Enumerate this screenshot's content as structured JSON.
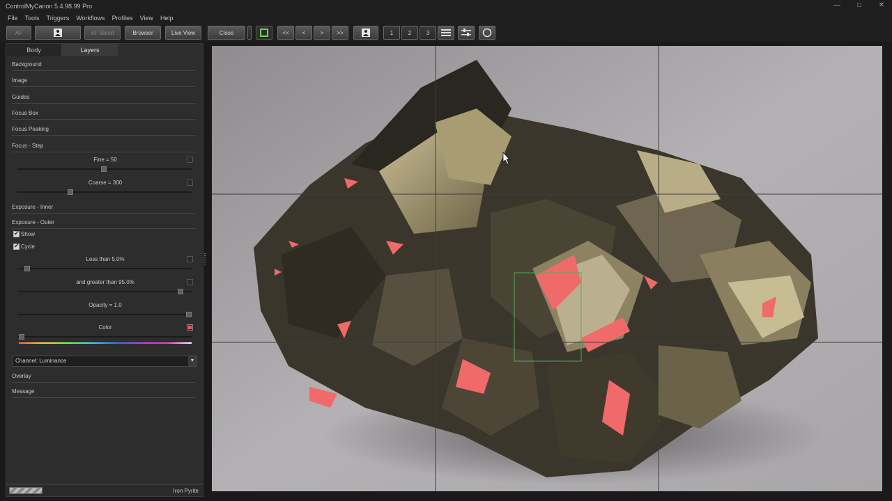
{
  "window": {
    "title": "ControlMyCanon 5.4.98.99 Pro"
  },
  "menu": [
    "File",
    "Tools",
    "Triggers",
    "Workflows",
    "Profiles",
    "View",
    "Help"
  ],
  "toolbar": {
    "af": "AF",
    "af_shoot": "AF Shoot",
    "browser": "Browser",
    "live_view": "Live View",
    "close": "Close",
    "first": "<<",
    "prev": "<",
    "next": ">",
    "last": ">>",
    "one": "1",
    "two": "2",
    "three": "3"
  },
  "tabs": {
    "body": "Body",
    "layers": "Layers"
  },
  "layers": {
    "background": "Background",
    "image": "Image",
    "guides": "Guides",
    "focus_box": "Focus Box",
    "focus_peaking": "Focus Peaking",
    "focus_step": "Focus - Step",
    "fine": "Fine = 50",
    "coarse": "Coarse = 300",
    "exposure_inner": "Exposure - Inner",
    "exposure_outer": "Exposure - Outer",
    "show": "Show",
    "cycle": "Cycle",
    "less_than": "Less than 5.0%",
    "greater_than": "and greater than 95.0%",
    "opacity": "Opacity = 1.0",
    "color": "Color",
    "channel": "Channel: Luminance",
    "overlay": "Overlay",
    "message": "Message"
  },
  "status": {
    "text": "Iron Pyrite"
  },
  "colors": {
    "highlight": "#f06a6a",
    "focus_box": "#4caf50",
    "accent_green": "#6fd15a"
  },
  "icons": [
    "person-icon",
    "list-icon",
    "settings-sliders-icon",
    "circle-icon",
    "minimize-icon",
    "maximize-icon",
    "close-icon"
  ]
}
